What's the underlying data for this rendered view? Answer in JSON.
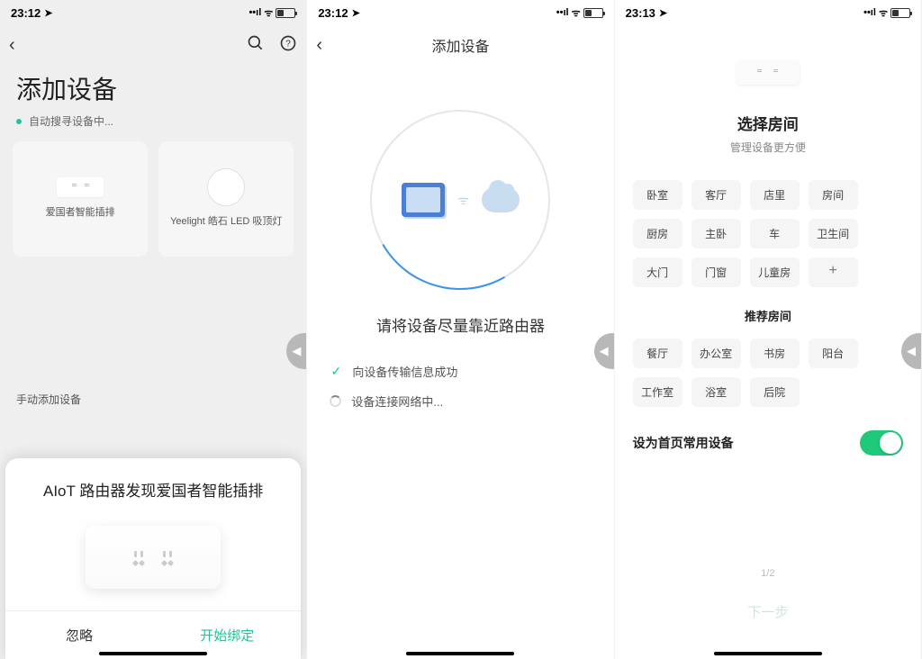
{
  "screen1": {
    "time": "23:12",
    "title": "添加设备",
    "searching": "自动搜寻设备中...",
    "devices": [
      {
        "label": "爱国者智能插排"
      },
      {
        "label": "Yeelight 皓石 LED 吸顶灯"
      }
    ],
    "manual_label": "手动添加设备",
    "sheet_title": "AIoT 路由器发现爱国者智能插排",
    "btn_ignore": "忽略",
    "btn_bind": "开始绑定"
  },
  "screen2": {
    "time": "23:12",
    "nav_title": "添加设备",
    "msg": "请将设备尽量靠近路由器",
    "status_ok": "向设备传输信息成功",
    "status_loading": "设备连接网络中..."
  },
  "screen3": {
    "time": "23:13",
    "title": "选择房间",
    "subtitle": "管理设备更方便",
    "rooms": [
      "卧室",
      "客厅",
      "店里",
      "房间",
      "厨房",
      "主卧",
      "车",
      "卫生间",
      "大门",
      "门窗",
      "儿童房"
    ],
    "section_recommend": "推荐房间",
    "rooms_recommend": [
      "餐厅",
      "办公室",
      "书房",
      "阳台",
      "工作室",
      "浴室",
      "后院"
    ],
    "toggle_label": "设为首页常用设备",
    "pager": "1/2",
    "next": "下一步"
  }
}
